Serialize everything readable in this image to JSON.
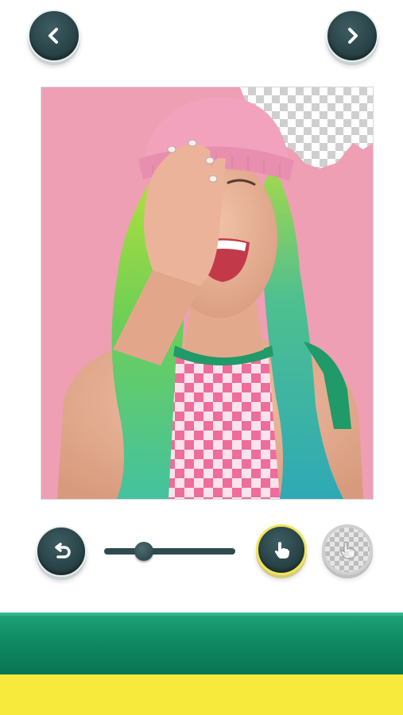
{
  "header": {
    "back_icon": "chevron-left-icon",
    "next_icon": "chevron-right-icon"
  },
  "canvas": {
    "description_icon": "edited-photo",
    "colors": {
      "background_pink": "#ee9fb4",
      "hat_pink": "#f2a2bd",
      "hair_green": "#7fd24a",
      "hair_teal": "#37b5ad",
      "shirt_green": "#1f9a68",
      "check_pink": "#ee6d9a",
      "skin": "#e7b297",
      "transparent_checker": "#c8c8c8"
    }
  },
  "toolbar": {
    "undo_icon": "undo-icon",
    "brush_size": 0.3,
    "hand_icon": "hand-touch-icon",
    "erase_icon": "transparent-hand-icon"
  },
  "colors": {
    "button_dark": "#2a4549",
    "accent_yellow": "#f2e45a",
    "bar_green": "#0e8c62",
    "bar_yellow": "#f7ea3c"
  }
}
